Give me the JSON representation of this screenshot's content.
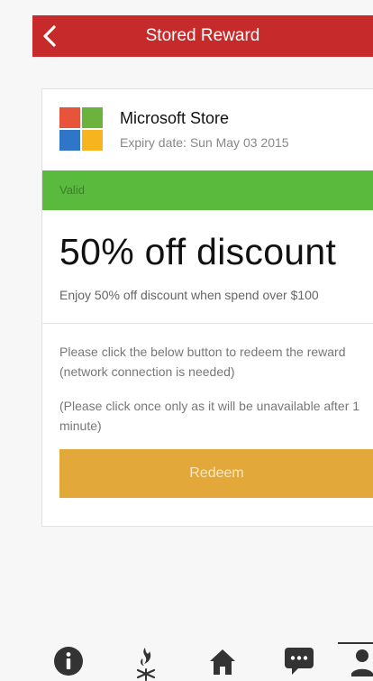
{
  "header": {
    "title": "Stored Reward",
    "back_icon": "chevron-left-icon",
    "bg_color": "#c62a2a"
  },
  "reward": {
    "store_name": "Microsoft Store",
    "expiry": "Expiry date: Sun May 03 2015",
    "status": "Valid",
    "status_color": "#5aba3e",
    "title": "50% off discount",
    "description": "Enjoy 50% off discount when spend over $100",
    "instruction_1": "Please click the below button to redeem the reward (network connection is needed)",
    "instruction_2": "(Please click once only as it will be unavailable after 1 minute)",
    "redeem_label": "Redeem",
    "redeem_color": "#e3a83a"
  },
  "tabbar": {
    "items": [
      {
        "icon": "info-icon"
      },
      {
        "icon": "campfire-icon"
      },
      {
        "icon": "home-icon"
      },
      {
        "icon": "chat-icon"
      },
      {
        "icon": "profile-icon",
        "active": true
      }
    ]
  }
}
